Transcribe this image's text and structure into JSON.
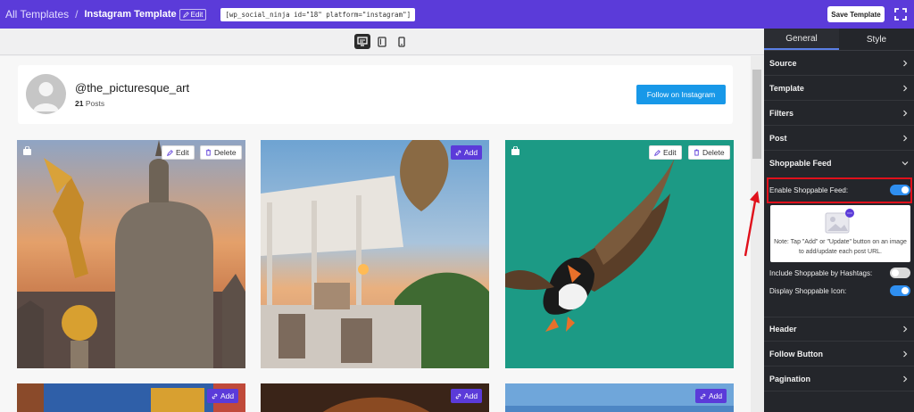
{
  "topbar": {
    "breadcrumb_root": "All Templates",
    "breadcrumb_sep": "/",
    "breadcrumb_current": "Instagram Template",
    "edit_label": "Edit",
    "shortcode": "[wp_social_ninja id=\"18\" platform=\"instagram\"]",
    "save_label": "Save Template"
  },
  "colors": {
    "brand": "#5b3bd9",
    "follow": "#1898e8",
    "sidebar": "#24262b",
    "toggle_on": "#2f8ff0",
    "highlight": "#e0101b"
  },
  "devices": [
    "desktop-icon",
    "tablet-icon",
    "mobile-icon"
  ],
  "profile": {
    "username": "@the_picturesque_art",
    "posts_count": "21",
    "posts_label": "Posts",
    "follow_label": "Follow on Instagram"
  },
  "feed": {
    "edit_label": "Edit",
    "delete_label": "Delete",
    "add_label": "Add"
  },
  "sidebar": {
    "tabs": [
      "General",
      "Style"
    ],
    "sections": {
      "source": "Source",
      "template": "Template",
      "filters": "Filters",
      "post": "Post",
      "shoppable": "Shoppable Feed",
      "header": "Header",
      "follow_button": "Follow Button",
      "pagination": "Pagination"
    },
    "enable_shoppable": {
      "label": "Enable Shoppable Feed:",
      "value": true
    },
    "note": "Note: Tap \"Add\" or \"Update\" button on an image to add/update each post URL.",
    "include_hashtags": {
      "label": "Include Shoppable by Hashtags:",
      "value": false
    },
    "display_icon": {
      "label": "Display Shoppable Icon:",
      "value": true
    }
  }
}
